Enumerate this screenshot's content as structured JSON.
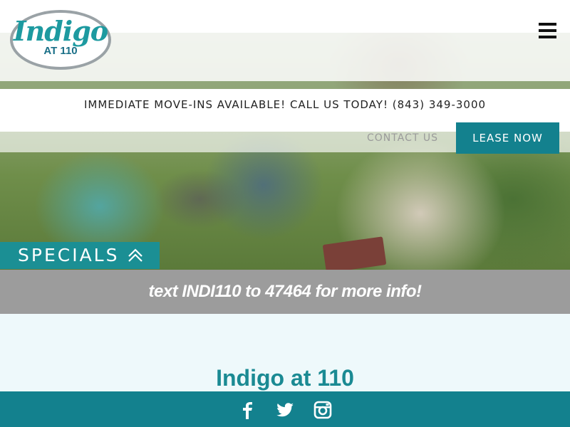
{
  "brand": {
    "logo_main": "Indigo",
    "logo_sub": "AT 110",
    "accent_color": "#13818e",
    "secondary_color": "#1b8f94"
  },
  "header": {
    "menu_icon": "hamburger-menu-icon"
  },
  "announcement": {
    "text": "IMMEDIATE MOVE-INS AVAILABLE! CALL US TODAY! (843) 349-3000"
  },
  "nav": {
    "contact_label": "CONTACT US",
    "lease_label": "LEASE NOW"
  },
  "specials": {
    "label": "SPECIALS",
    "icon": "double-chevron-up-icon"
  },
  "promo": {
    "text": "text INDI110 to 47464 for more info!"
  },
  "main": {
    "title": "Indigo at 110"
  },
  "footer": {
    "social": [
      {
        "name": "facebook",
        "icon": "facebook-icon"
      },
      {
        "name": "twitter",
        "icon": "twitter-icon"
      },
      {
        "name": "instagram",
        "icon": "instagram-icon"
      }
    ]
  }
}
